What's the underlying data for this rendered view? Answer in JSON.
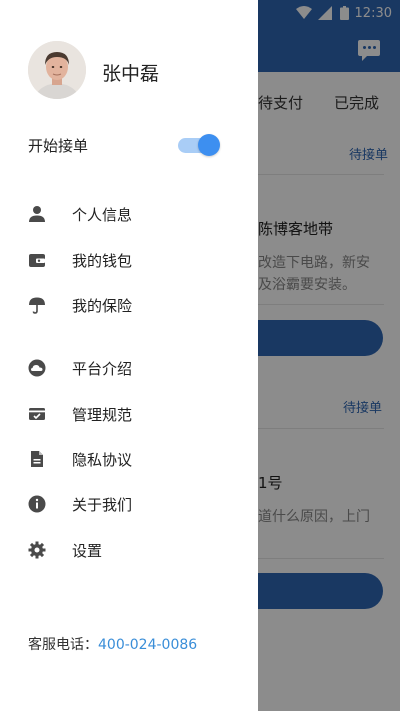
{
  "status_bar": {
    "time": "12:30"
  },
  "background": {
    "tabs": [
      "待支付",
      "已完成"
    ],
    "orders": [
      {
        "status": "待接单",
        "title": "陈博客地带",
        "desc_line1": "改造下电路，新安",
        "desc_line2": "及浴霸要安装。"
      },
      {
        "status": "待接单",
        "title": "1号",
        "desc_line1": "道什么原因，上门",
        "desc_line2": ""
      }
    ]
  },
  "drawer": {
    "user_name": "张中磊",
    "accept_orders_label": "开始接单",
    "accept_orders_on": true,
    "menu_group_1": [
      {
        "label": "个人信息",
        "icon": "person-icon"
      },
      {
        "label": "我的钱包",
        "icon": "wallet-icon"
      },
      {
        "label": "我的保险",
        "icon": "umbrella-icon"
      }
    ],
    "menu_group_2": [
      {
        "label": "平台介绍",
        "icon": "cloud-icon"
      },
      {
        "label": "管理规范",
        "icon": "card-check-icon"
      },
      {
        "label": "隐私协议",
        "icon": "document-icon"
      },
      {
        "label": "关于我们",
        "icon": "info-icon"
      },
      {
        "label": "设置",
        "icon": "gear-icon"
      }
    ],
    "service_label": "客服电话：",
    "service_phone": "400-024-0086"
  },
  "colors": {
    "brand_blue": "#2f66b3",
    "toggle_knob": "#3d8ff0",
    "toggle_track": "#a9cdf6",
    "link_blue": "#3a8ed8"
  }
}
